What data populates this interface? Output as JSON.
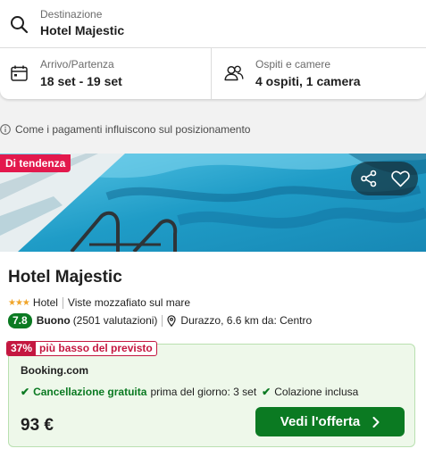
{
  "search": {
    "destination_label": "Destinazione",
    "destination_value": "Hotel Majestic",
    "dates_label": "Arrivo/Partenza",
    "dates_value": "18 set - 19 set",
    "guests_label": "Ospiti e camere",
    "guests_value": "4 ospiti, 1 camera"
  },
  "info": {
    "ranking_note": "Come i pagamenti influiscono sul posizionamento"
  },
  "hotel": {
    "badge": "Di tendenza",
    "name": "Hotel Majestic",
    "stars": 3,
    "stars_glyph": "★★★",
    "type": "Hotel",
    "tagline": "Viste mozzafiato sul mare",
    "rating_score": "7.8",
    "rating_word": "Buono",
    "rating_count": "(2501 valutazioni)",
    "location": "Durazzo, 6.6 km da: Centro"
  },
  "deal": {
    "percent": "37%",
    "badge_text": "più basso del previsto",
    "provider": "Booking.com",
    "free_cancel": "Cancellazione gratuita",
    "cancel_detail": "prima del giorno: 3 set",
    "breakfast": "Colazione inclusa",
    "price": "93 €",
    "cta": "Vedi l'offerta"
  },
  "colors": {
    "accent_green": "#0b7a22",
    "trend_red": "#e3194d",
    "deal_red": "#c41740",
    "deal_background": "#eef8ea",
    "star_orange": "#f0a52a"
  },
  "icons": [
    "search-icon",
    "calendar-icon",
    "guests-icon",
    "info-icon",
    "share-icon",
    "heart-icon",
    "location-pin-icon",
    "check-icon",
    "chevron-right-icon"
  ]
}
